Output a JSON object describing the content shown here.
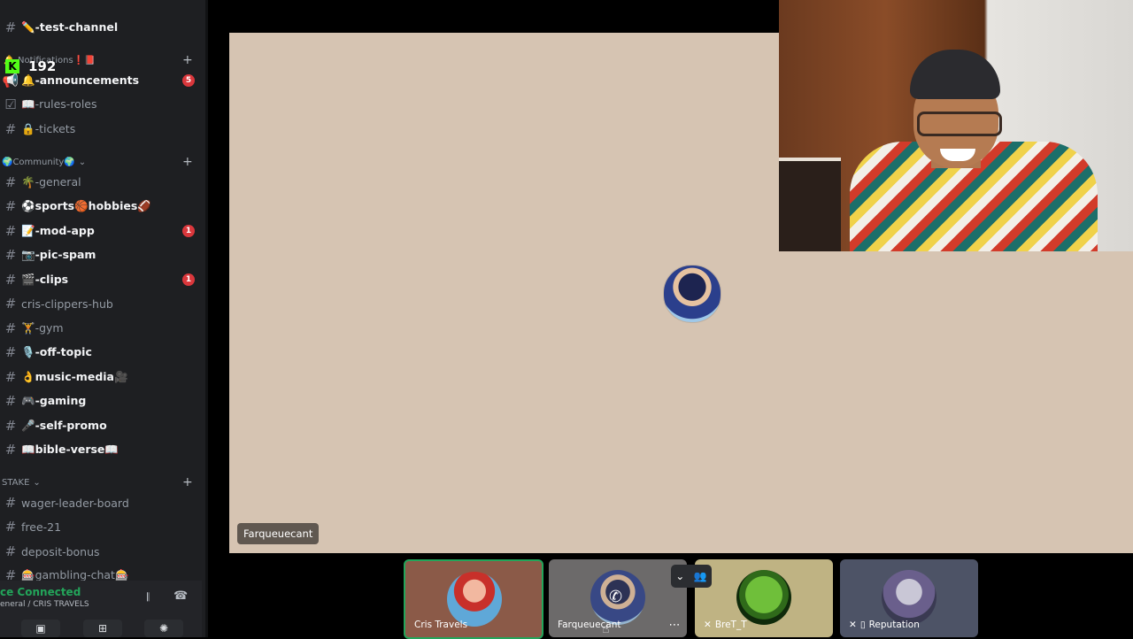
{
  "kick": {
    "icon": "kick-logo-icon",
    "viewer_count": "192"
  },
  "sidebar": {
    "top_channel": {
      "name": "✏️-test-channel"
    },
    "notifications_category": {
      "label": "🔔-Notifications❗📕"
    },
    "community_category": {
      "label": "🌍Community🌍"
    },
    "stake_category": {
      "label": "STAKE"
    },
    "channels": [
      {
        "name": "🔔-announcements",
        "badge": "5",
        "icon": "megaphone-icon"
      },
      {
        "name": "📖-rules-roles",
        "icon": "checkbox-icon"
      },
      {
        "name": "🔒-tickets",
        "icon": "hash-icon"
      },
      {
        "name": "🌴-general",
        "icon": "hash-icon"
      },
      {
        "name": "⚽sports🏀hobbies🏈",
        "icon": "hash-icon"
      },
      {
        "name": "📝-mod-app",
        "badge": "1",
        "icon": "hash-icon"
      },
      {
        "name": "📷-pic-spam",
        "icon": "hash-icon"
      },
      {
        "name": "🎬-clips",
        "badge": "1",
        "icon": "hash-icon"
      },
      {
        "name": "cris-clippers-hub",
        "icon": "hash-icon"
      },
      {
        "name": "🏋️-gym",
        "icon": "hash-icon"
      },
      {
        "name": "🎙️-off-topic",
        "icon": "hash-icon"
      },
      {
        "name": "👌music-media🎥",
        "icon": "hash-icon"
      },
      {
        "name": "🎮-gaming",
        "icon": "hash-icon"
      },
      {
        "name": "🎤-self-promo",
        "icon": "hash-icon"
      },
      {
        "name": "📖bible-verse📖",
        "icon": "hash-icon"
      },
      {
        "name": "wager-leader-board",
        "icon": "hash-icon"
      },
      {
        "name": "free-21",
        "icon": "hash-icon"
      },
      {
        "name": "deposit-bonus",
        "icon": "hash-icon"
      },
      {
        "name": "🎰gambling-chat🎰",
        "icon": "hash-icon"
      }
    ],
    "voice": {
      "status": "ce Connected",
      "subtitle": "eneral / CRIS TRAVELS"
    }
  },
  "stage": {
    "speaker_name": "Farqueuecant"
  },
  "tiles": [
    {
      "name": "Cris Travels",
      "speaking": true
    },
    {
      "name": "Farqueuecant"
    },
    {
      "name": "BreT_T"
    },
    {
      "name": "Reputation"
    }
  ],
  "colors": {
    "accent_green": "#23a55a",
    "badge_red": "#da373c",
    "stage_bg": "#d6c4b2"
  }
}
